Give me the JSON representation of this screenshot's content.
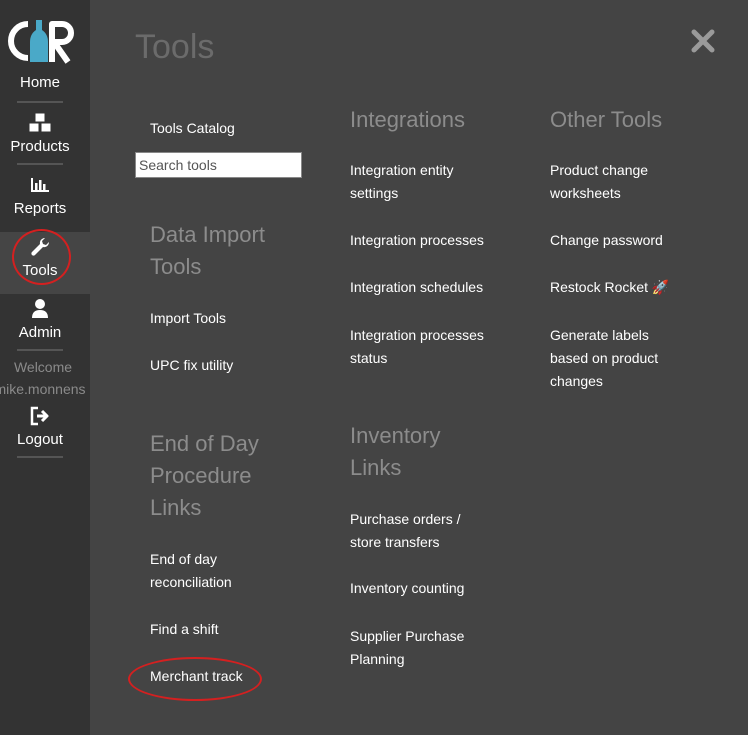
{
  "logo": {
    "text": "CR"
  },
  "sidebar": {
    "items": [
      {
        "label": "Home",
        "icon": "home"
      },
      {
        "label": "Products",
        "icon": "boxes-icon"
      },
      {
        "label": "Reports",
        "icon": "bar-chart-icon"
      },
      {
        "label": "Tools",
        "icon": "wrench-icon"
      },
      {
        "label": "Admin",
        "icon": "user-icon"
      }
    ],
    "welcome": "Welcome",
    "username": "mike.monnens",
    "logout": {
      "label": "Logout",
      "icon": "sign-out-icon"
    }
  },
  "page": {
    "title": "Tools"
  },
  "search": {
    "placeholder": "Search tools"
  },
  "col1": {
    "tools_catalog": "Tools Catalog",
    "data_import": {
      "title_line1": "Data Import",
      "title_line2": "Tools",
      "links": [
        "Import Tools",
        "UPC fix utility"
      ]
    },
    "eod": {
      "title_line1": "End of Day",
      "title_line2": "Procedure",
      "title_line3": "Links",
      "links": [
        {
          "line1": "End of day",
          "line2": "reconciliation"
        },
        {
          "line1": "Find a shift"
        },
        {
          "line1": "Merchant track"
        }
      ]
    }
  },
  "col2": {
    "integrations": {
      "title": "Integrations",
      "links": [
        {
          "line1": "Integration entity",
          "line2": "settings"
        },
        {
          "line1": "Integration processes"
        },
        {
          "line1": "Integration schedules"
        },
        {
          "line1": "Integration processes",
          "line2": "status"
        }
      ]
    },
    "inventory": {
      "title_line1": "Inventory",
      "title_line2": "Links",
      "links": [
        {
          "line1": "Purchase orders /",
          "line2": "store transfers"
        },
        {
          "line1": "Inventory counting"
        },
        {
          "line1": "Supplier Purchase",
          "line2": "Planning"
        }
      ]
    }
  },
  "col3": {
    "other": {
      "title": "Other Tools",
      "links": [
        {
          "line1": "Product change",
          "line2": "worksheets"
        },
        {
          "line1": "Change password"
        },
        {
          "line1": "Restock Rocket 🚀"
        },
        {
          "line1": "Generate labels",
          "line2": "based on product",
          "line3": "changes"
        }
      ]
    }
  },
  "colors": {
    "background": "#444444",
    "sidebar": "#333333",
    "logo_accent": "#4aa9c8",
    "highlight_circle": "#d42020"
  }
}
